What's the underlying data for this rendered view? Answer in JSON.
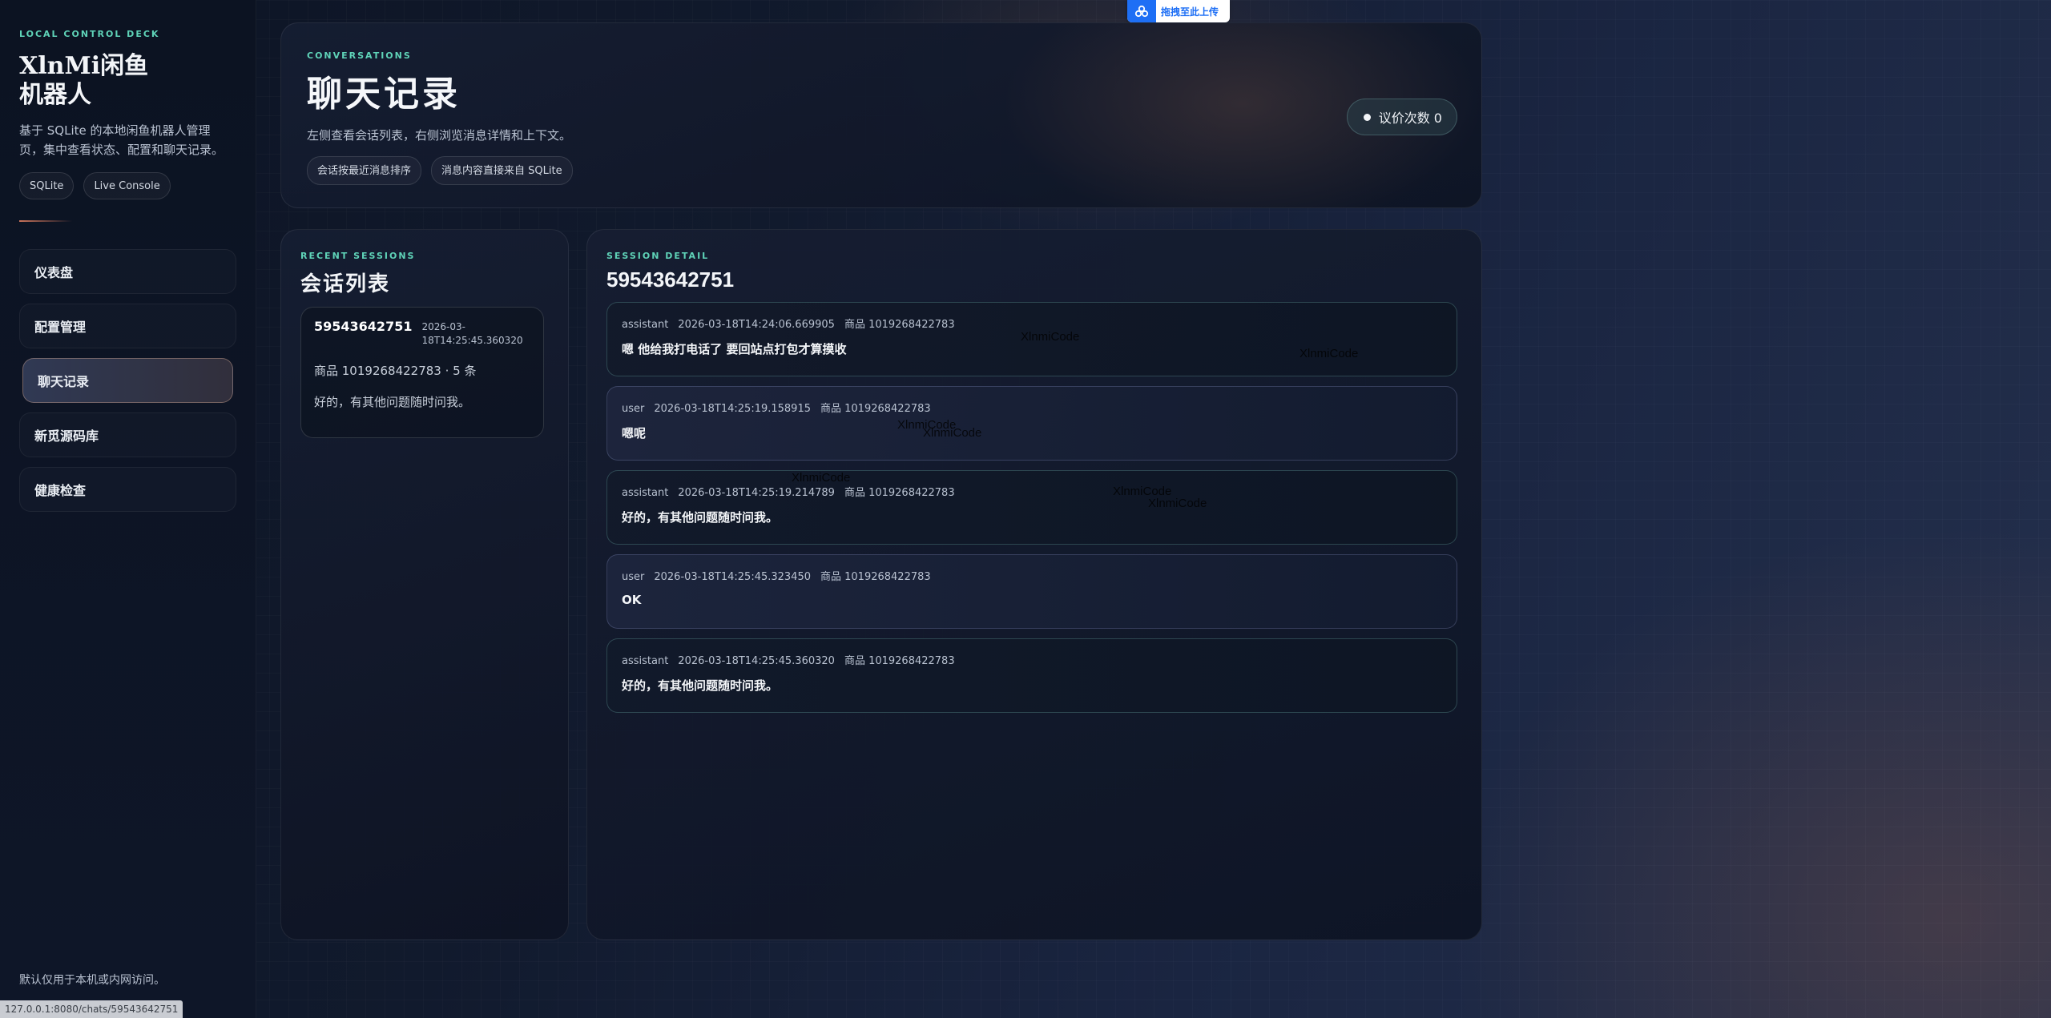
{
  "sidebar": {
    "eyebrow": "LOCAL CONTROL DECK",
    "title": "XlnMi闲鱼机器人",
    "description": "基于 SQLite 的本地闲鱼机器人管理页，集中查看状态、配置和聊天记录。",
    "chips": [
      "SQLite",
      "Live Console"
    ],
    "nav": [
      {
        "label": "仪表盘",
        "active": false
      },
      {
        "label": "配置管理",
        "active": false
      },
      {
        "label": "聊天记录",
        "active": true
      },
      {
        "label": "新觅源码库",
        "active": false
      },
      {
        "label": "健康检查",
        "active": false
      }
    ],
    "footer": "默认仅用于本机或内网访问。"
  },
  "status_url": "127.0.0.1:8080/chats/59543642751",
  "upload_badge": "拖拽至此上传",
  "hero": {
    "eyebrow": "CONVERSATIONS",
    "title": "聊天记录",
    "description": "左侧查看会话列表，右侧浏览消息详情和上下文。",
    "chips": [
      "会话按最近消息排序",
      "消息内容直接来自 SQLite"
    ],
    "haggle_label": "议价次数 0"
  },
  "sessions": {
    "eyebrow": "RECENT SESSIONS",
    "title": "会话列表",
    "items": [
      {
        "id": "59543642751",
        "time": "2026-03-18T14:25:45.360320",
        "meta": "商品 1019268422783 · 5 条",
        "last": "好的，有其他问题随时问我。"
      }
    ]
  },
  "detail": {
    "eyebrow": "SESSION DETAIL",
    "title": "59543642751",
    "messages": [
      {
        "role": "assistant",
        "time": "2026-03-18T14:24:06.669905",
        "item": "商品 1019268422783",
        "text": "嗯 他给我打电话了 要回站点打包才算摸收"
      },
      {
        "role": "user",
        "time": "2026-03-18T14:25:19.158915",
        "item": "商品 1019268422783",
        "text": "嗯呢"
      },
      {
        "role": "assistant",
        "time": "2026-03-18T14:25:19.214789",
        "item": "商品 1019268422783",
        "text": "好的，有其他问题随时问我。"
      },
      {
        "role": "user",
        "time": "2026-03-18T14:25:45.323450",
        "item": "商品 1019268422783",
        "text": "OK"
      },
      {
        "role": "assistant",
        "time": "2026-03-18T14:25:45.360320",
        "item": "商品 1019268422783",
        "text": "好的，有其他问题随时问我。"
      }
    ]
  },
  "watermark_text": "XlnmiCode",
  "colors": {
    "accent_teal": "#5fd3b8",
    "accent_rose": "#c9735a",
    "upload_blue": "#1e6ff5"
  }
}
